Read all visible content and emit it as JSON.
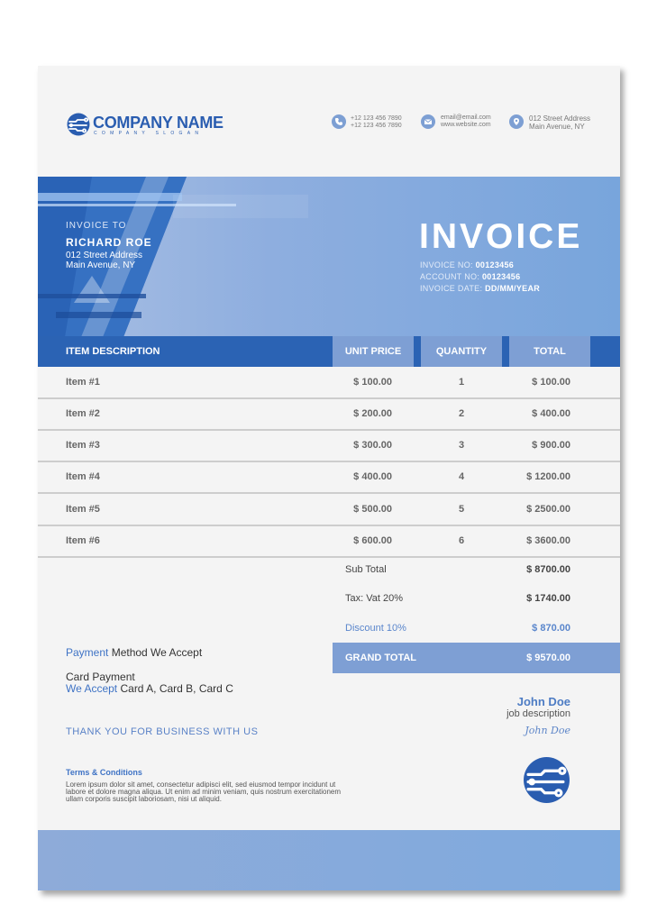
{
  "header": {
    "company_name": "COMPANY NAME",
    "company_slogan": "COMPANY SLOGAN",
    "phone_lines": [
      "+12 123 456 7890",
      "+12 123 456 7890"
    ],
    "email_lines": [
      "email@email.com",
      "www.website.com"
    ],
    "address_lines": [
      "012 Street Address",
      "Main Avenue, NY"
    ]
  },
  "banner": {
    "invoice_to_label": "INVOICE TO",
    "client_name": "RICHARD ROE",
    "client_address": [
      "012 Street Address",
      "Main Avenue, NY"
    ],
    "title": "INVOICE",
    "meta": [
      {
        "label": "INVOICE NO:",
        "value": "00123456"
      },
      {
        "label": "ACCOUNT NO:",
        "value": "00123456"
      },
      {
        "label": "INVOICE DATE:",
        "value": "DD/MM/YEAR"
      }
    ]
  },
  "table": {
    "headers": [
      "ITEM DESCRIPTION",
      "UNIT PRICE",
      "QUANTITY",
      "TOTAL"
    ],
    "rows": [
      {
        "desc": "Item #1",
        "price": "$ 100.00",
        "qty": "1",
        "total": "$ 100.00"
      },
      {
        "desc": "Item #2",
        "price": "$ 200.00",
        "qty": "2",
        "total": "$ 400.00"
      },
      {
        "desc": "Item #3",
        "price": "$ 300.00",
        "qty": "3",
        "total": "$ 900.00"
      },
      {
        "desc": "Item #4",
        "price": "$ 400.00",
        "qty": "4",
        "total": "$ 1200.00"
      },
      {
        "desc": "Item #5",
        "price": "$ 500.00",
        "qty": "5",
        "total": "$ 2500.00"
      },
      {
        "desc": "Item #6",
        "price": "$ 600.00",
        "qty": "6",
        "total": "$ 3600.00"
      }
    ]
  },
  "summary": {
    "subtotal_label": "Sub Total",
    "subtotal_value": "$ 8700.00",
    "tax_label": "Tax: Vat 20%",
    "tax_value": "$ 1740.00",
    "discount_label": "Discount 10%",
    "discount_value": "$ 870.00",
    "grand_label": "GRAND TOTAL",
    "grand_value": "$ 9570.00"
  },
  "payment": {
    "title_highlight": "Payment",
    "title_rest": " Method We Accept",
    "card_line": "Card Payment",
    "accept_highlight": "We Accept",
    "accept_rest": " Card A, Card B, Card C"
  },
  "thanks": "THANK YOU FOR BUSINESS WITH US",
  "terms": {
    "title": "Terms & Conditions",
    "text": "Lorem ipsum dolor sit amet, consectetur adipisci elit, sed eiusmod tempor incidunt ut labore et dolore magna aliqua. Ut enim ad minim veniam, quis nostrum exercitationem ullam corporis suscipit laboriosam, nisi ut aliquid."
  },
  "signature": {
    "name": "John Doe",
    "description": "job description",
    "script": "John Doe"
  },
  "colors": {
    "primary": "#2b63b4",
    "accent": "#7e9fd4",
    "text_blue": "#3f73c5"
  }
}
